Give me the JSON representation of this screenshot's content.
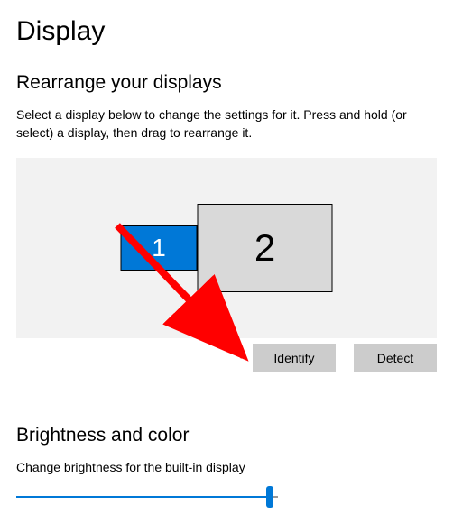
{
  "page_title": "Display",
  "rearrange": {
    "heading": "Rearrange your displays",
    "description": "Select a display below to change the settings for it. Press and hold (or select) a display, then drag to rearrange it.",
    "monitors": [
      {
        "label": "1"
      },
      {
        "label": "2"
      }
    ],
    "identify_label": "Identify",
    "detect_label": "Detect"
  },
  "brightness": {
    "heading": "Brightness and color",
    "slider_label": "Change brightness for the built-in display",
    "value_percent": 97
  },
  "colors": {
    "accent": "#0078d7",
    "panel_bg": "#f2f2f2",
    "button_bg": "#cccccc",
    "inactive_monitor_bg": "#d9d9d9"
  }
}
